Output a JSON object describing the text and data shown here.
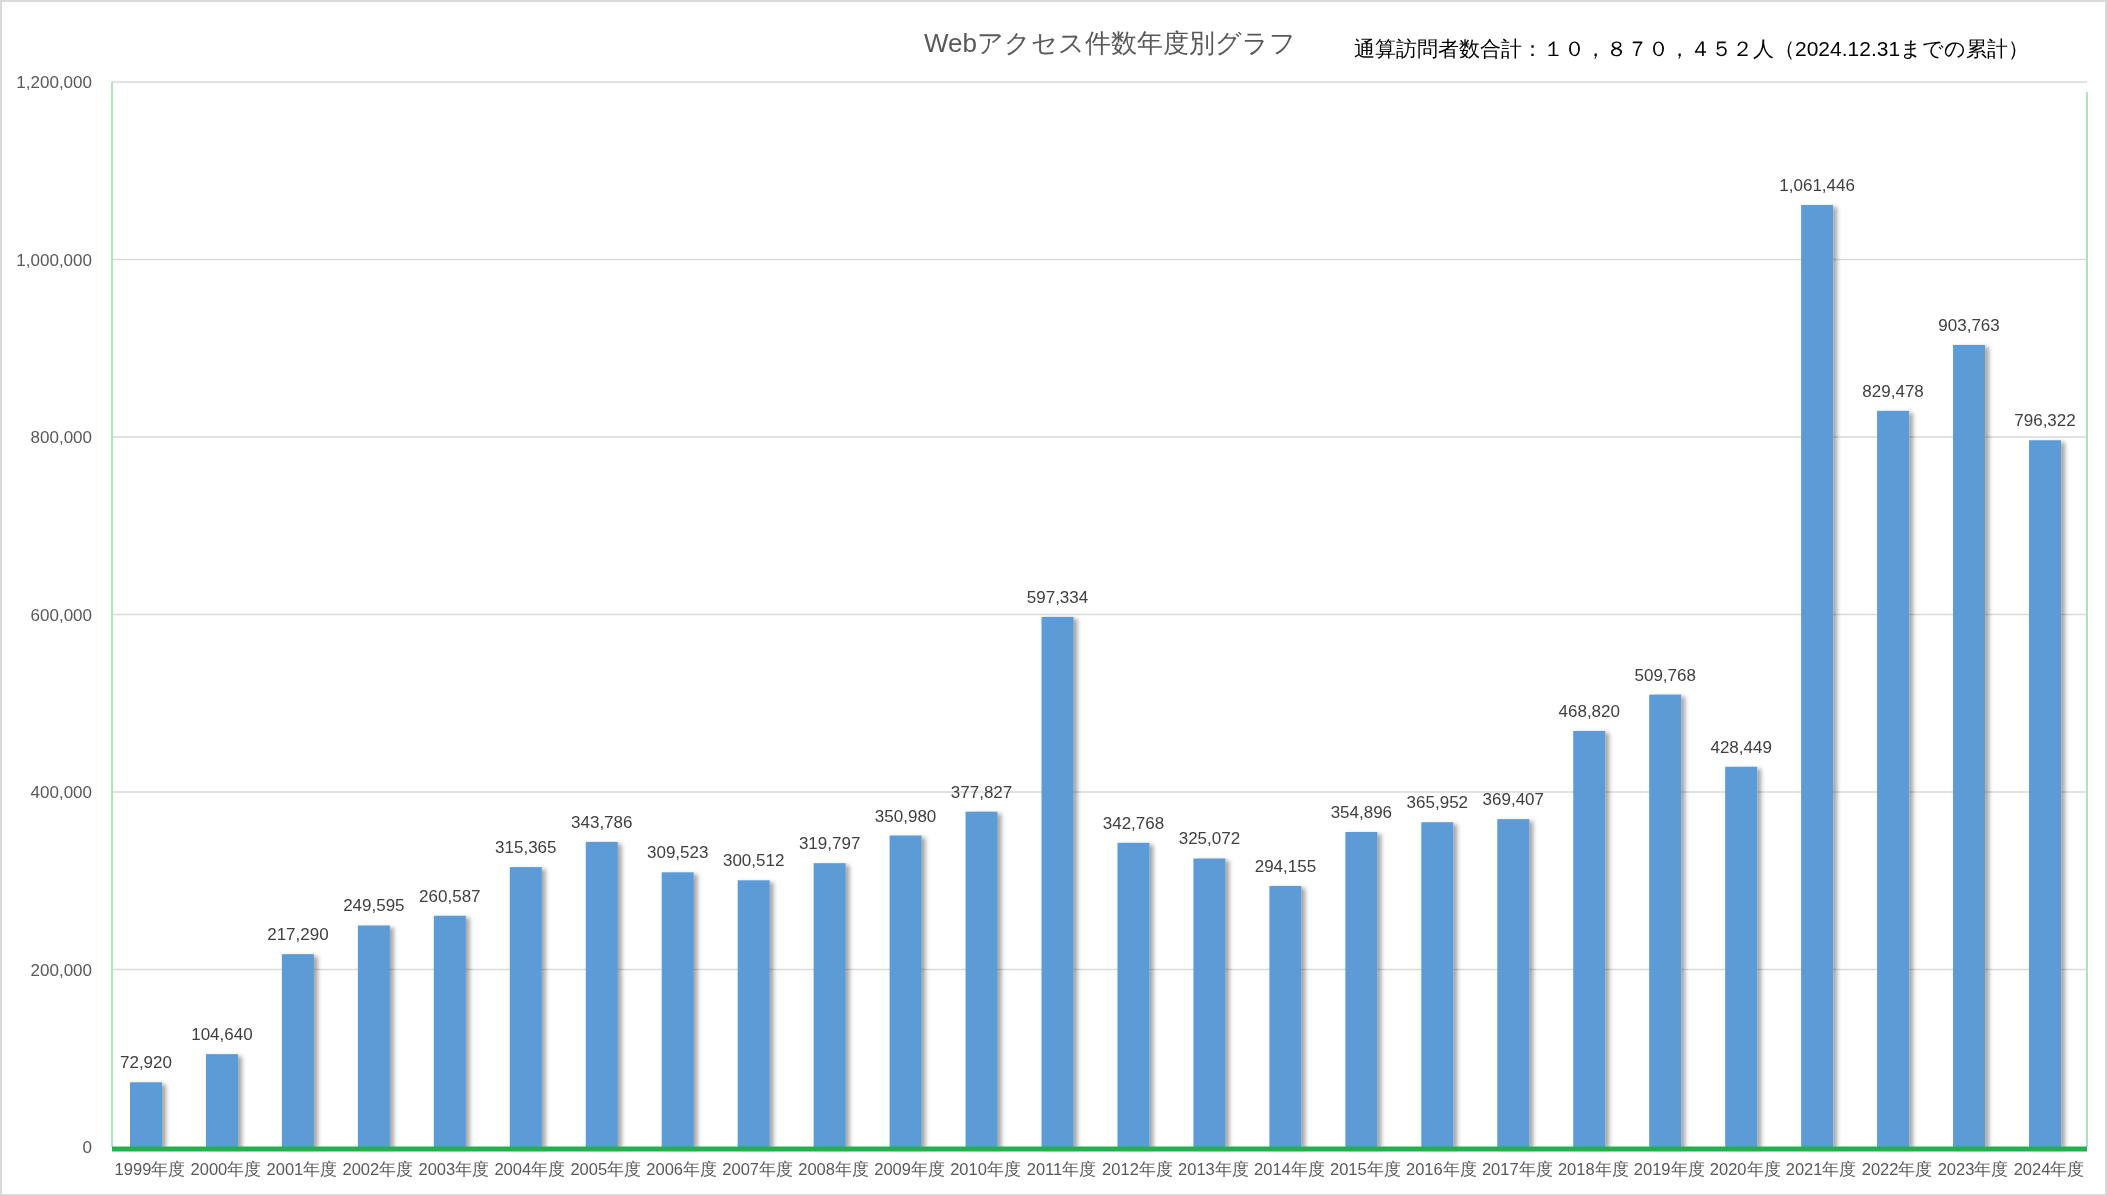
{
  "chart": {
    "note": "通算訪問者数合計：１０，８７０，４５２人（2024.12.31までの累計）",
    "chart_data": {
      "type": "bar",
      "title": "Webアクセス件数年度別グラフ",
      "categories": [
        "1999年度",
        "2000年度",
        "2001年度",
        "2002年度",
        "2003年度",
        "2004年度",
        "2005年度",
        "2006年度",
        "2007年度",
        "2008年度",
        "2009年度",
        "2010年度",
        "2011年度",
        "2012年度",
        "2013年度",
        "2014年度",
        "2015年度",
        "2016年度",
        "2017年度",
        "2018年度",
        "2019年度",
        "2020年度",
        "2021年度",
        "2022年度",
        "2023年度",
        "2024年度"
      ],
      "grid": true,
      "series": [
        {
          "color": "#5b9bd5",
          "values": [
            72920,
            104640,
            217290,
            249595,
            260587,
            315365,
            343786,
            309523,
            300512,
            319797,
            350980,
            377827,
            597334,
            342768,
            325072,
            294155,
            354896,
            365952,
            369407,
            468820,
            509768,
            428449,
            1061446,
            829478,
            903763,
            796322
          ]
        }
      ],
      "value_labels": [
        "72,920",
        "104,640",
        "217,290",
        "249,595",
        "260,587",
        "315,365",
        "343,786",
        "309,523",
        "300,512",
        "319,797",
        "350,980",
        "377,827",
        "597,334",
        "342,768",
        "325,072",
        "294,155",
        "354,896",
        "365,952",
        "369,407",
        "468,820",
        "509,768",
        "428,449",
        "1,061,446",
        "829,478",
        "903,763",
        "796,322"
      ],
      "ylim": [
        0,
        1200000
      ],
      "yticks": [
        {
          "value": 0,
          "label": "0"
        },
        {
          "value": 200000,
          "label": "200,000"
        },
        {
          "value": 400000,
          "label": "400,000"
        },
        {
          "value": 600000,
          "label": "600,000"
        },
        {
          "value": 800000,
          "label": "800,000"
        },
        {
          "value": 1000000,
          "label": "1,000,000"
        },
        {
          "value": 1200000,
          "label": "1,200,000"
        }
      ]
    }
  }
}
